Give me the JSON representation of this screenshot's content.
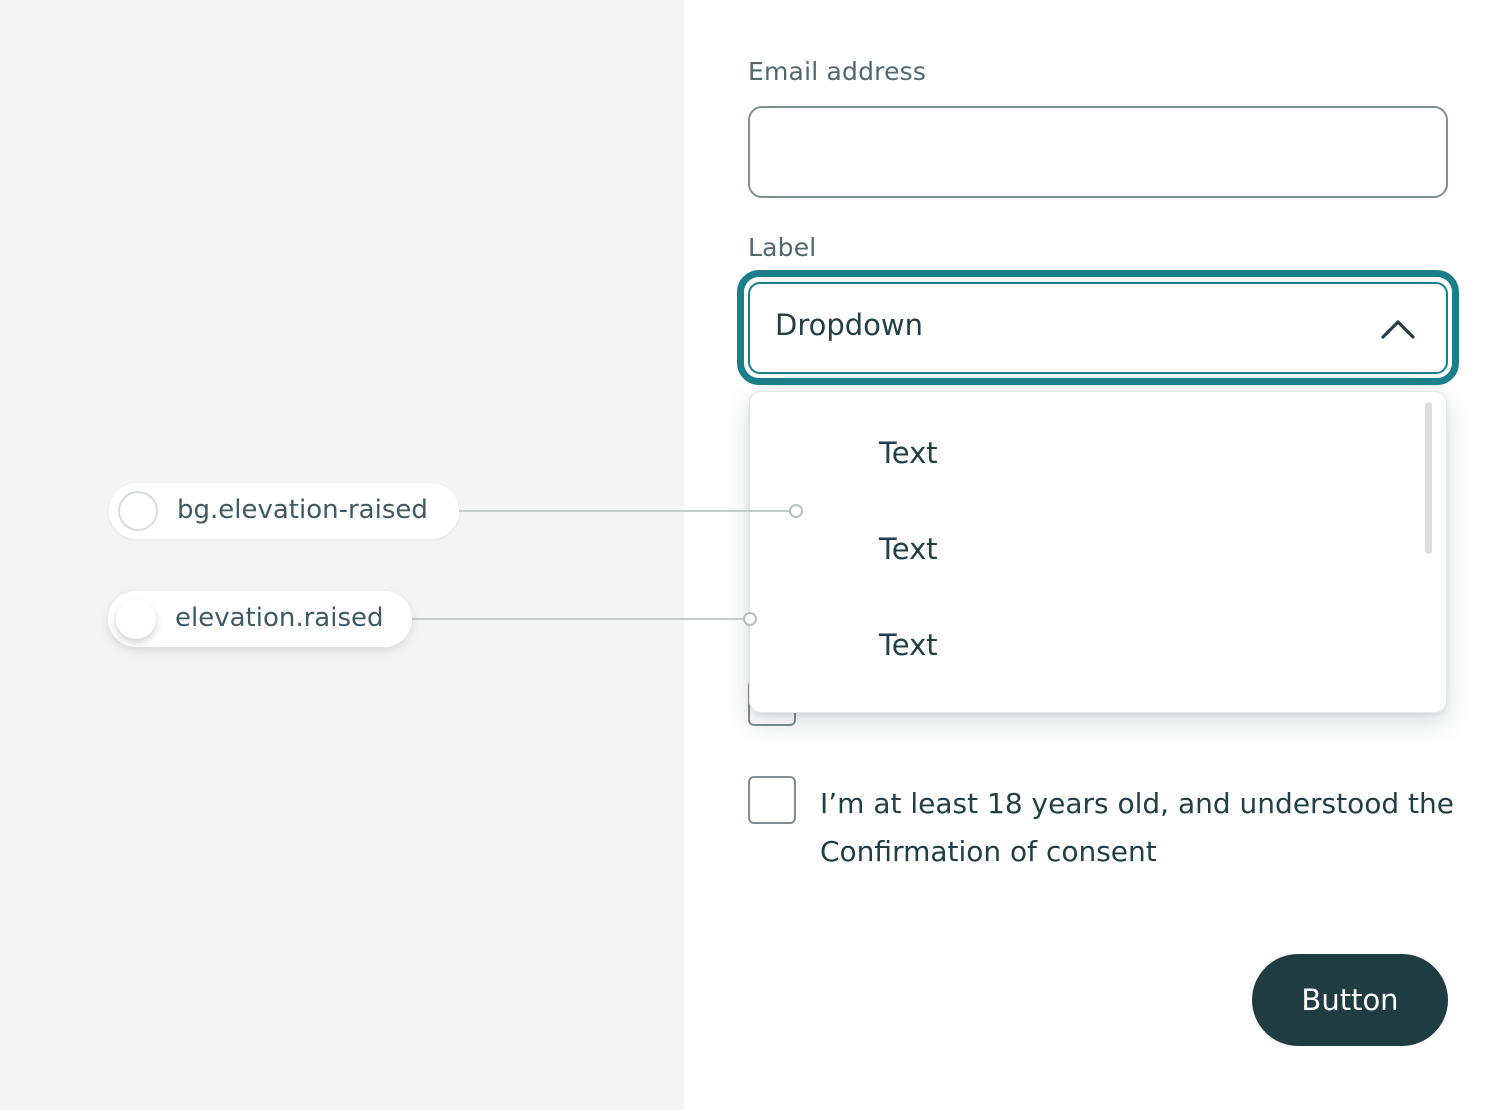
{
  "form": {
    "email_label": "Email address",
    "email_value": "",
    "dropdown_label": "Label",
    "dropdown_value": "Dropdown",
    "dropdown_options": [
      "Text",
      "Text",
      "Text"
    ],
    "hidden_row_text": "",
    "consent_text": "I’m at least 18 years old, and understood the Confirmation of consent",
    "button_label": "Button"
  },
  "annotations": [
    {
      "token": "bg.elevation-raised"
    },
    {
      "token": "elevation.raised"
    }
  ],
  "icons": {
    "dropdown_toggle": "chevron-up-icon"
  },
  "colors": {
    "focus_ring": "#1b7f8a",
    "primary_button": "#203c43",
    "text": "#213f45",
    "left_panel_bg": "#f3f4f3"
  }
}
